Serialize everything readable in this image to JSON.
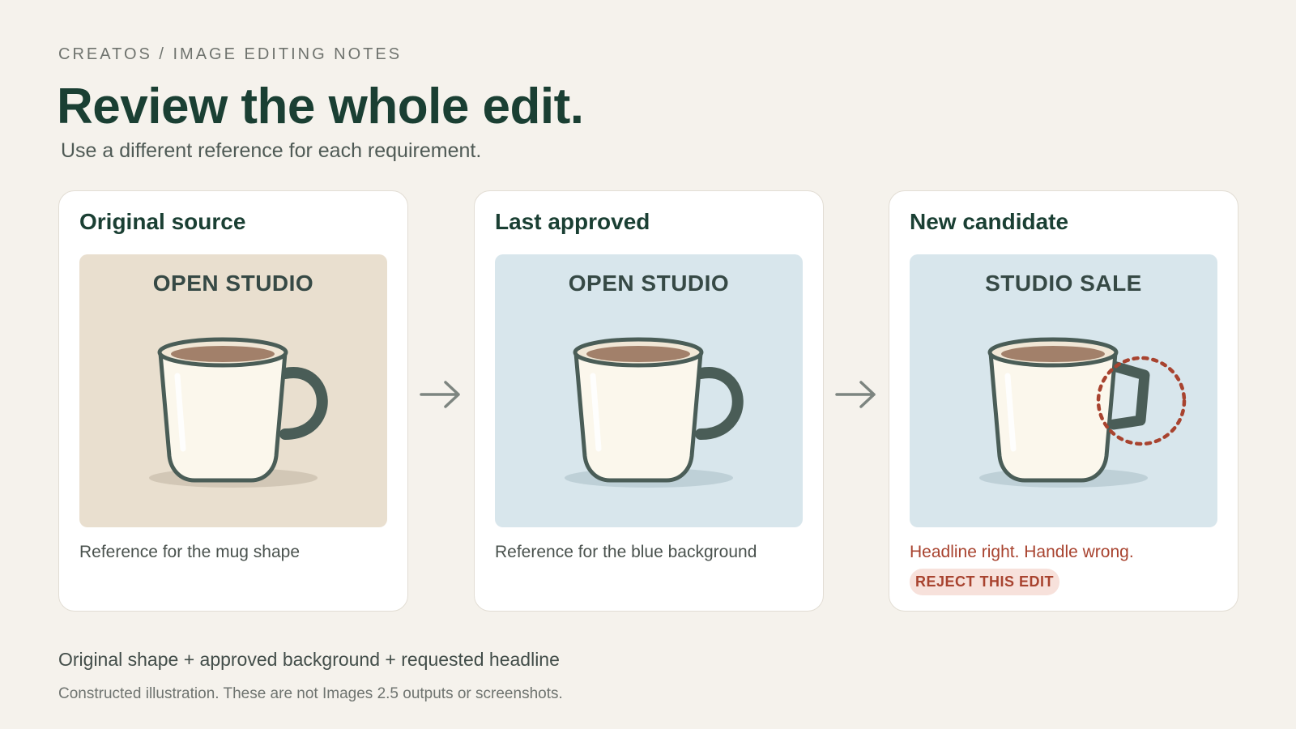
{
  "header": {
    "eyebrow": "CREATOS / IMAGE EDITING NOTES",
    "title": "Review the whole edit.",
    "subtitle": "Use a different reference for each requirement."
  },
  "cards": [
    {
      "title": "Original source",
      "headline": "OPEN STUDIO",
      "background": "#e9dfcf",
      "handle": "round",
      "caption": "Reference for the mug shape"
    },
    {
      "title": "Last approved",
      "headline": "OPEN STUDIO",
      "background": "#d8e6ec",
      "handle": "round",
      "caption": "Reference for the blue background"
    },
    {
      "title": "New candidate",
      "headline": "STUDIO SALE",
      "background": "#d8e6ec",
      "handle": "square-flagged",
      "caption": "Headline right. Handle wrong.",
      "badge": "REJECT THIS EDIT"
    }
  ],
  "footer": {
    "formula": "Original shape + approved background + requested headline",
    "note": "Constructed illustration. These are not Images 2.5 outputs or screenshots."
  },
  "colors": {
    "page_bg": "#f5f2ec",
    "title": "#1a3f33",
    "mug_outline": "#4a5d57",
    "mug_body": "#fbf7ec",
    "coffee": "#a2806a",
    "warning": "#a8432f",
    "badge_bg": "#f7e1db"
  },
  "icons": [
    "arrow-right-icon",
    "mug-icon",
    "dashed-circle-icon"
  ]
}
